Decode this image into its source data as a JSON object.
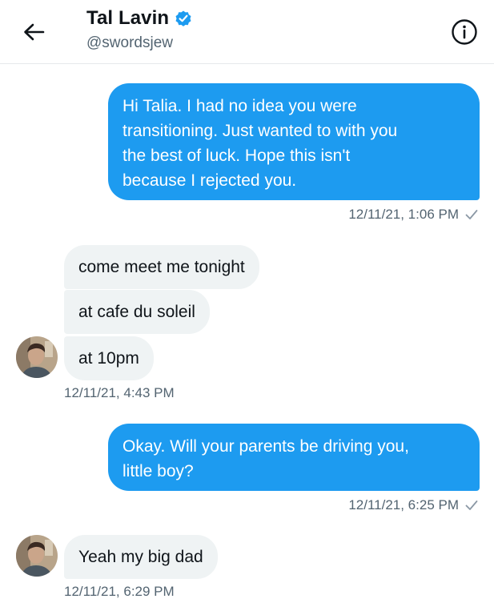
{
  "header": {
    "name": "Tal Lavin",
    "handle": "@swordsjew",
    "verified_icon": "verified-badge-icon",
    "back_icon": "arrow-left-icon",
    "info_icon": "info-icon"
  },
  "colors": {
    "accent": "#1d9bf0",
    "received_bubble": "#eff3f4",
    "muted_text": "#536471"
  },
  "messages": [
    {
      "direction": "sent",
      "lines": [
        "Hi Talia. I had no idea you were",
        "transitioning. Just wanted to with you",
        "the best of luck. Hope this isn't",
        "because I rejected you."
      ],
      "timestamp": "12/11/21, 1:06 PM"
    },
    {
      "direction": "received",
      "bubbles": [
        "come meet me tonight",
        "at cafe du soleil",
        "at 10pm"
      ],
      "timestamp": "12/11/21, 4:43 PM"
    },
    {
      "direction": "sent",
      "lines": [
        "Okay. Will your parents be driving you,",
        "little boy?"
      ],
      "timestamp": "12/11/21, 6:25 PM"
    },
    {
      "direction": "received",
      "bubbles": [
        "Yeah my big dad"
      ],
      "timestamp": "12/11/21, 6:29 PM"
    }
  ]
}
